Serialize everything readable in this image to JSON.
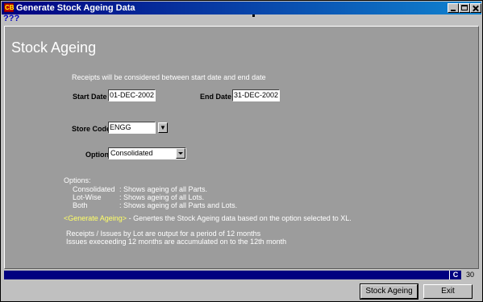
{
  "window": {
    "title": "Generate Stock Ageing Data",
    "icon": "app-icon"
  },
  "menu": {
    "help": "???"
  },
  "main": {
    "heading": "Stock Ageing",
    "info": "Receipts will be considered between start date and end date",
    "start_date_label": "Start Date",
    "start_date_value": "01-DEC-2002",
    "end_date_label": "End Date",
    "end_date_value": "31-DEC-2002",
    "store_code_label": "Store Code",
    "store_code_value": "ENGG",
    "option_label": "Option",
    "option_value": "Consolidated",
    "options_header": "Options:",
    "options": [
      {
        "name": "Consolidated",
        "desc": ": Shows ageing of all Parts."
      },
      {
        "name": "Lot-Wise",
        "desc": ": Shows ageing of all Lots."
      },
      {
        "name": "Both",
        "desc": ": Shows ageing of all Parts and Lots."
      }
    ],
    "generate_link": "<Generate Ageing>",
    "generate_desc": " - Genertes the Stock Ageing data based on the option selected to XL.",
    "note1": "Receipts / Issues by Lot are output for a period of 12 months",
    "note2": "Issues execeeding 12 months are accumulated on to the 12th month"
  },
  "status": {
    "mode": "C",
    "number": "30"
  },
  "buttons": {
    "stock_ageing": "Stock Ageing",
    "exit": "Exit"
  }
}
